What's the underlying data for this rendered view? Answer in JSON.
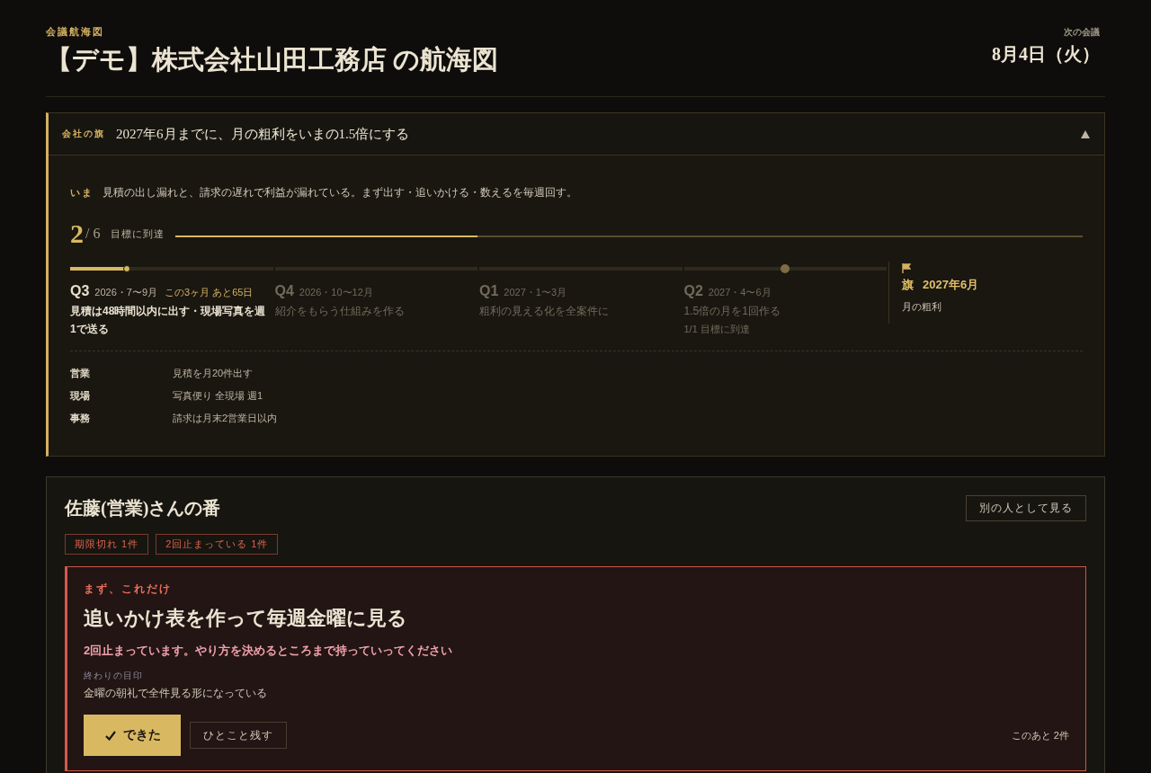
{
  "header": {
    "eyebrow": "会議航海図",
    "title": "【デモ】株式会社山田工務店 の航海図",
    "next_meeting": {
      "label": "次の会議",
      "date": "8月4日（火）"
    }
  },
  "flag_panel": {
    "label": "会社の旗",
    "goal": "2027年6月までに、月の粗利をいまの1.5倍にする",
    "expanded": true,
    "now": {
      "label": "いま",
      "text": "見積の出し漏れと、請求の遅れで利益が漏れている。まず出す・追いかける・数えるを毎週回す。"
    },
    "progress": {
      "done": "2",
      "total": "/ 6",
      "caption": "目標に到達",
      "level": 0.333
    },
    "quarters": [
      {
        "name": "Q3",
        "period": "2026・7〜9月",
        "badge": "この3ヶ月 あと65日",
        "goal": "見積は48時間以内に出す・現場写真を週1で送る",
        "current": true,
        "level": 0.28,
        "milestone": false
      },
      {
        "name": "Q4",
        "period": "2026・10〜12月",
        "goal": "紹介をもらう仕組みを作る",
        "current": false,
        "milestone": false
      },
      {
        "name": "Q1",
        "period": "2027・1〜3月",
        "goal": "粗利の見える化を全案件に",
        "current": false,
        "milestone": false
      },
      {
        "name": "Q2",
        "period": "2027・4〜6月",
        "goal": "1.5倍の月を1回作る",
        "note": "1/1 目標に到達",
        "current": false,
        "milestone": true
      }
    ],
    "flag": {
      "label": "旗",
      "date": "2027年6月",
      "metric": "月の粗利"
    },
    "departments": [
      {
        "name": "営業",
        "target": "見積を月20件出す"
      },
      {
        "name": "現場",
        "target": "写真便り 全現場 週1"
      },
      {
        "name": "事務",
        "target": "請求は月末2営業日以内"
      }
    ]
  },
  "turn": {
    "title": "佐藤(営業)さんの番",
    "switch_button": "別の人として見る",
    "tags": [
      "期限切れ 1件",
      "2回止まっている 1件"
    ],
    "focus": {
      "eyebrow": "まず、これだけ",
      "title": "追いかけ表を作って毎週金曜に見る",
      "warning": "2回止まっています。やり方を決めるところまで持っていってください",
      "done_label": "終わりの目印",
      "done_text": "金曜の朝礼で全件見る形になっている",
      "primary_button": "できた",
      "secondary_button": "ひとこと残す",
      "remaining": "このあと 2件"
    }
  }
}
